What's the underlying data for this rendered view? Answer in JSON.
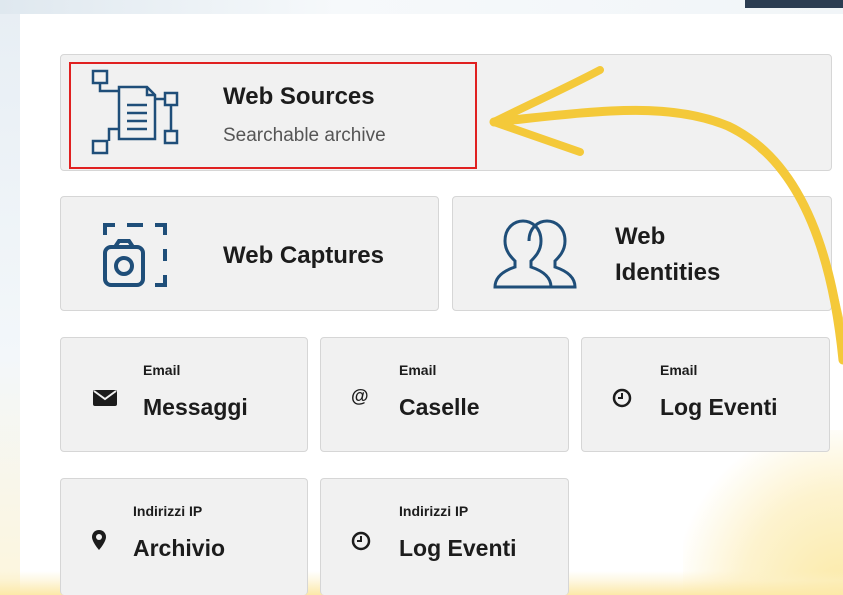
{
  "tiles": {
    "web_sources": {
      "title": "Web Sources",
      "subtitle": "Searchable archive",
      "icon": "document-network-icon"
    },
    "web_captures": {
      "title": "Web Captures",
      "icon": "camera-capture-icon"
    },
    "web_identities": {
      "title_line1": "Web",
      "title_line2": "Identities",
      "icon": "users-icon"
    },
    "email_messaggi": {
      "caption": "Email",
      "title": "Messaggi",
      "icon": "envelope-icon"
    },
    "email_caselle": {
      "caption": "Email",
      "title": "Caselle",
      "icon": "at-sign-icon"
    },
    "email_log_eventi": {
      "caption": "Email",
      "title": "Log Eventi",
      "icon": "clock-icon"
    },
    "ip_archivio": {
      "caption": "Indirizzi IP",
      "title": "Archivio",
      "icon": "map-pin-icon"
    },
    "ip_log_eventi": {
      "caption": "Indirizzi IP",
      "title": "Log Eventi",
      "icon": "clock-icon"
    }
  },
  "colors": {
    "accent_blue": "#1f4e79",
    "highlight_red": "#e02020",
    "arrow_yellow": "#f4c93a",
    "tile_bg": "#f1f1f1"
  }
}
